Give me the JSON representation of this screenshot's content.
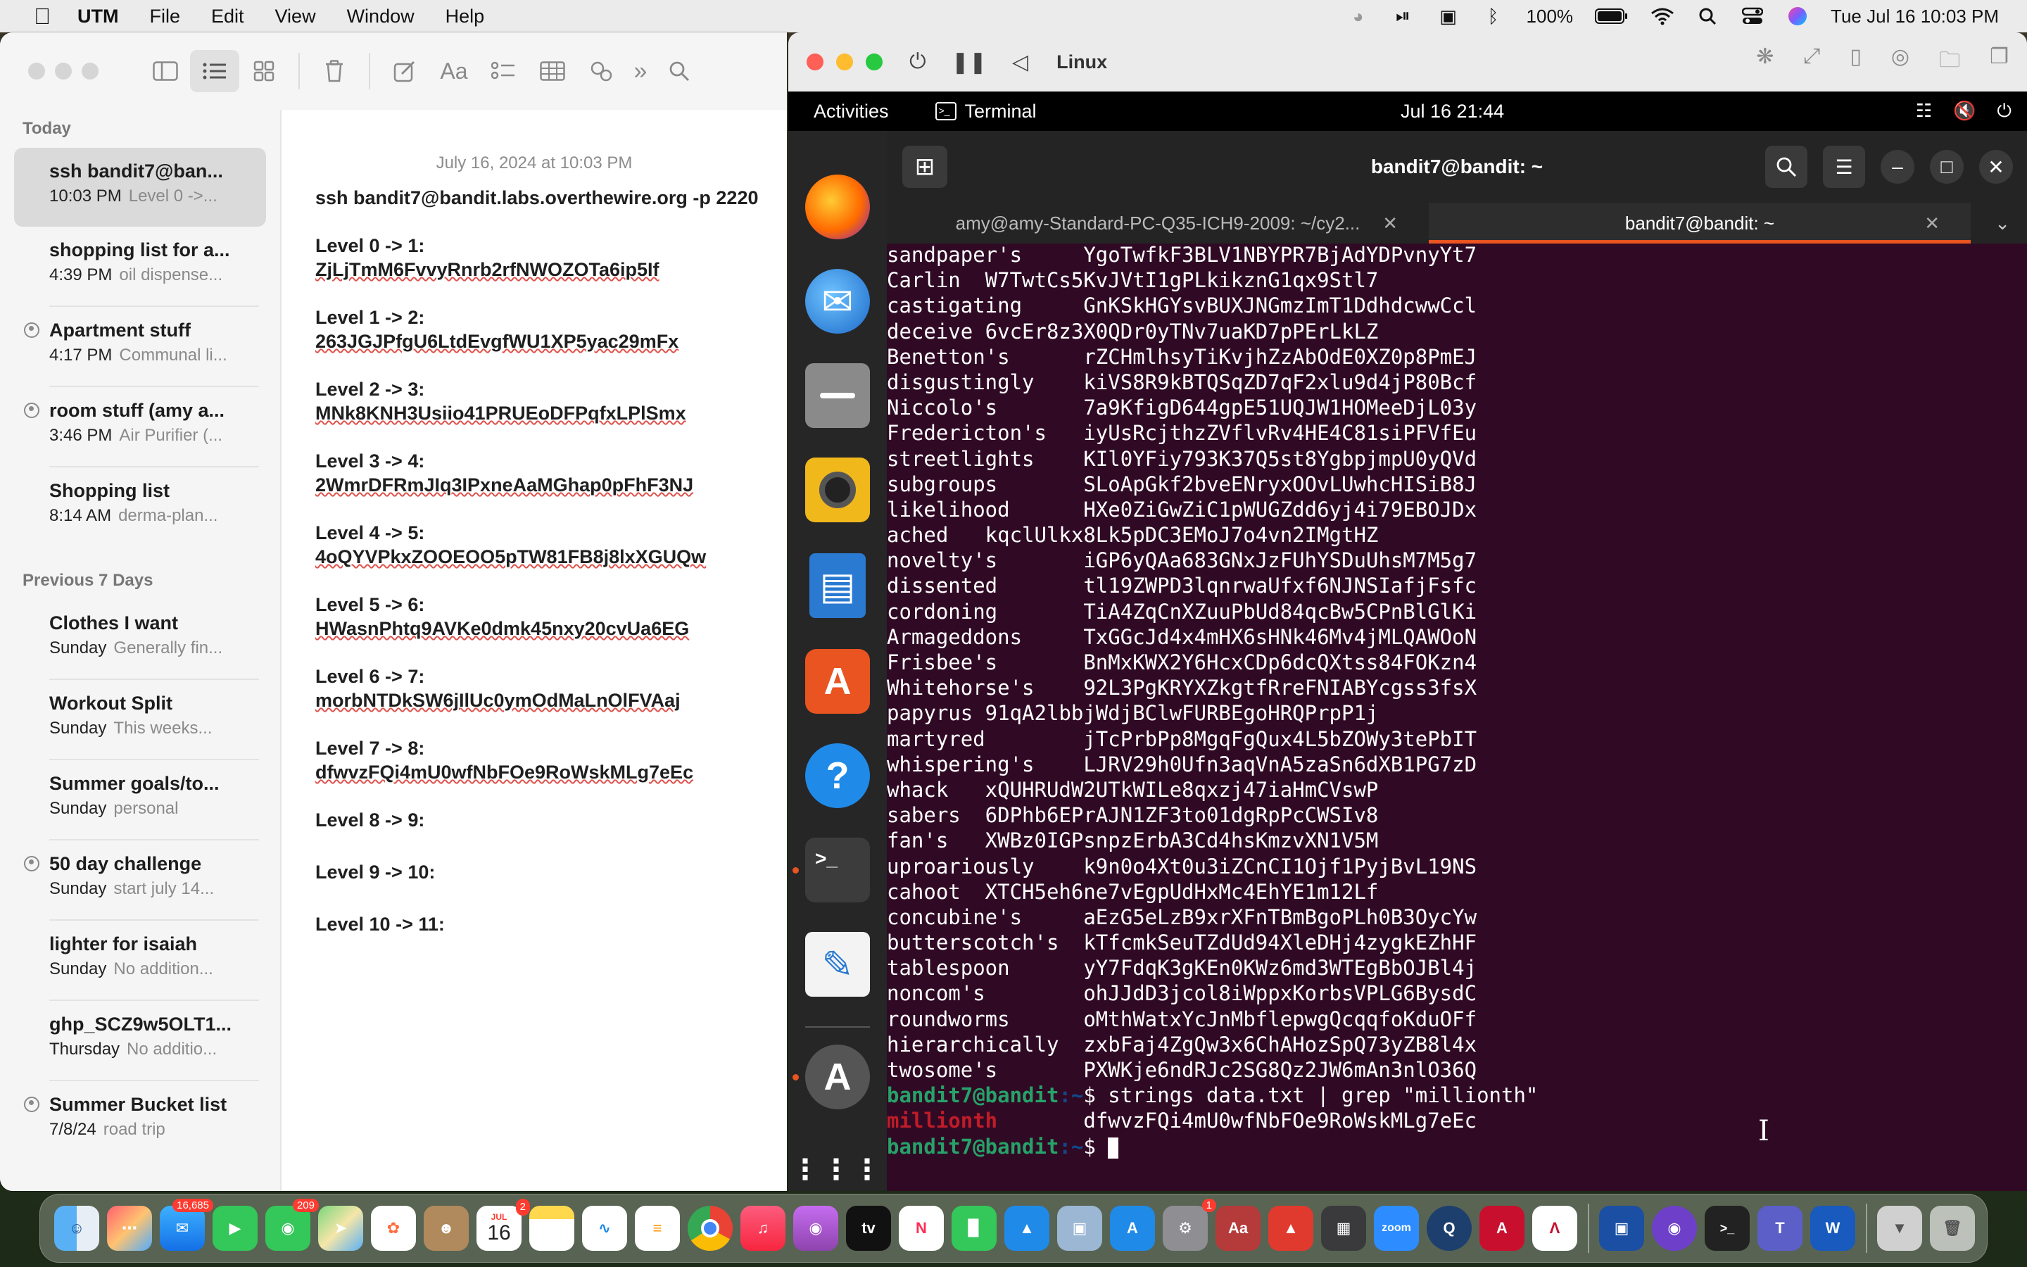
{
  "menubar": {
    "app": "UTM",
    "items": [
      "File",
      "Edit",
      "View",
      "Window",
      "Help"
    ],
    "battery": "100%",
    "datetime": "Tue Jul 16  10:03 PM"
  },
  "notes": {
    "sections": {
      "today": "Today",
      "previous": "Previous 7 Days"
    },
    "today_items": [
      {
        "title": "ssh bandit7@ban...",
        "time": "10:03 PM",
        "preview": "Level 0 ->...",
        "shared": false
      },
      {
        "title": "shopping list for a...",
        "time": "4:39 PM",
        "preview": "oil dispense...",
        "shared": false
      },
      {
        "title": "Apartment stuff",
        "time": "4:17 PM",
        "preview": "Communal li...",
        "shared": true
      },
      {
        "title": "room stuff (amy a...",
        "time": "3:46 PM",
        "preview": "Air Purifier (...",
        "shared": true
      },
      {
        "title": "Shopping list",
        "time": "8:14 AM",
        "preview": "derma-plan...",
        "shared": false
      }
    ],
    "previous_items": [
      {
        "title": "Clothes I want",
        "time": "Sunday",
        "preview": "Generally fin...",
        "shared": false
      },
      {
        "title": "Workout Split",
        "time": "Sunday",
        "preview": "This weeks...",
        "shared": false
      },
      {
        "title": "Summer goals/to...",
        "time": "Sunday",
        "preview": "personal",
        "shared": false
      },
      {
        "title": "50 day challenge",
        "time": "Sunday",
        "preview": "start july 14...",
        "shared": true
      },
      {
        "title": "lighter for isaiah",
        "time": "Sunday",
        "preview": "No addition...",
        "shared": false
      },
      {
        "title": "ghp_SCZ9w5OLT1...",
        "time": "Thursday",
        "preview": "No additio...",
        "shared": false
      },
      {
        "title": "Summer Bucket list",
        "time": "7/8/24",
        "preview": "road trip",
        "shared": true
      }
    ],
    "editor": {
      "date": "July 16, 2024 at 10:03 PM",
      "command": "ssh bandit7@bandit.labs.overthewire.org -p 2220",
      "levels": [
        {
          "label": "Level 0 -> 1:",
          "password": "ZjLjTmM6FvvyRnrb2rfNWOZOTa6ip5If"
        },
        {
          "label": "Level 1 -> 2:",
          "password": "263JGJPfgU6LtdEvgfWU1XP5yac29mFx"
        },
        {
          "label": "Level 2 -> 3:",
          "password": "MNk8KNH3Usiio41PRUEoDFPqfxLPlSmx"
        },
        {
          "label": "Level 3 -> 4:",
          "password": "2WmrDFRmJIq3IPxneAaMGhap0pFhF3NJ"
        },
        {
          "label": "Level 4 -> 5:",
          "password": "4oQYVPkxZOOEOO5pTW81FB8j8lxXGUQw"
        },
        {
          "label": "Level 5 -> 6:",
          "password": "HWasnPhtq9AVKe0dmk45nxy20cvUa6EG"
        },
        {
          "label": "Level 6 -> 7:",
          "password": "morbNTDkSW6jIlUc0ymOdMaLnOlFVAaj"
        },
        {
          "label": "Level 7 -> 8:",
          "password": "dfwvzFQi4mU0wfNbFOe9RoWskMLg7eEc"
        },
        {
          "label": "Level 8 -> 9:",
          "password": ""
        },
        {
          "label": "Level 9 -> 10:",
          "password": ""
        },
        {
          "label": "Level 10 -> 11:",
          "password": ""
        }
      ]
    }
  },
  "utm": {
    "vm_name": "Linux",
    "gnome": {
      "activities": "Activities",
      "app_indicator": "Terminal",
      "clock": "Jul 16  21:44"
    },
    "terminal": {
      "window_title": "bandit7@bandit: ~",
      "tabs": [
        {
          "label": "amy@amy-Standard-PC-Q35-ICH9-2009: ~/cy2...",
          "active": false
        },
        {
          "label": "bandit7@bandit: ~",
          "active": true
        }
      ],
      "output_lines": [
        "sandpaper's     YgoTwfkF3BLV1NBYPR7BjAdYDPvnyYt7",
        "Carlin  W7TwtCs5KvJVtI1gPLkikznG1qx9Stl7",
        "castigating     GnKSkHGYsvBUXJNGmzImT1DdhdcwwCcl",
        "deceive 6vcEr8z3X0QDr0yTNv7uaKD7pPErLkLZ",
        "Benetton's      rZCHmlhsyTiKvjhZzAbOdE0XZ0p8PmEJ",
        "disgustingly    kiVS8R9kBTQSqZD7qF2xlu9d4jP80Bcf",
        "Niccolo's       7a9KfigD644gpE51UQJW1HOMeeDjL03y",
        "Fredericton's   iyUsRcjthzZVflvRv4HE4C81siPFVfEu",
        "streetlights    KIl0YFiy793K37Q5st8YgbpjmpU0yQVd",
        "subgroups       SLoApGkf2bveENryxOOvLUwhcHISiB8J",
        "likelihood      HXe0ZiGwZiC1pWUGZdd6yj4i79EBOJDx",
        "ached   kqclUlkx8Lk5pDC3EMoJ7o4vn2IMgtHZ",
        "novelty's       iGP6yQAa683GNxJzFUhYSDuUhsM7M5g7",
        "dissented       tl19ZWPD3lqnrwaUfxf6NJNSIafjFsfc",
        "cordoning       TiA4ZqCnXZuuPbUd84qcBw5CPnBlGlKi",
        "Armageddons     TxGGcJd4x4mHX6sHNk46Mv4jMLQAWOoN",
        "Frisbee's       BnMxKWX2Y6HcxCDp6dcQXtss84FOKzn4",
        "Whitehorse's    92L3PgKRYXZkgtfRreFNIABYcgss3fsX",
        "papyrus 91qA2lbbjWdjBClwFURBEgoHRQPrpP1j",
        "martyred        jTcPrbPp8MgqFgQux4L5bZOWy3tePbIT",
        "whispering's    LJRV29h0Ufn3aqVnA5zaSn6dXB1PG7zD",
        "whack   xQUHRUdW2UTkWILe8qxzj47iaHmCVswP",
        "sabers  6DPhb6EPrAJN1ZF3to01dgRpPcCWSIv8",
        "fan's   XWBz0IGPsnpzErbA3Cd4hsKmzvXN1V5M",
        "uproariously    k9n0o4Xt0u3iZCnCI1Ojf1PyjBvL19NS",
        "cahoot  XTCH5eh6ne7vEgpUdHxMc4EhYE1m12Lf",
        "concubine's     aEzG5eLzB9xrXFnTBmBgoPLh0B3OycYw",
        "butterscotch's  kTfcmkSeuTZdUd94XleDHj4zygkEZhHF",
        "tablespoon      yY7FdqK3gKEn0KWz6md3WTEgBbOJBl4j",
        "noncom's        ohJJdD3jcol8iWppxKorbsVPLG6BysdC",
        "roundworms      oMthWatxYcJnMbflepwgQcqqfoKduOFf",
        "hierarchically  zxbFaj4ZgQw3x6ChAHozSpQ73yZB8l4x",
        "twosome's       PXWKje6ndRJc2SG8Qz2JW6mAn3nlO36Q"
      ],
      "prompt_user": "bandit7@bandit",
      "prompt_path": ":~",
      "prompt_symbol": "$ ",
      "command": "strings data.txt | grep \"millionth\"",
      "match_word": "millionth",
      "match_value": "       dfwvzFQi4mU0wfNbFOe9RoWskMLg7eEc"
    }
  },
  "macdock": {
    "mail_badge": "16,685",
    "messages_badge": "209",
    "calendar_month": "JUL",
    "calendar_day": "16",
    "calendar_badge": "2",
    "settings_badge": "1",
    "zoom_label": "zoom",
    "tv_label": "tv",
    "dict_label": "Aa"
  },
  "colors": {
    "accent_ubuntu": "#e95420",
    "terminal_bg": "#300a24",
    "prompt_green": "#26a269",
    "prompt_blue": "#12488b",
    "grep_match_red": "#c01c28"
  }
}
